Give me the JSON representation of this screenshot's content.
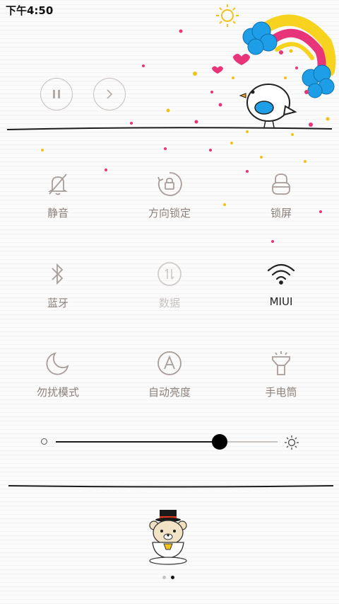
{
  "status_bar": {
    "time": "下午4:50"
  },
  "media": {
    "pause_label": "",
    "next_label": ""
  },
  "toggles": [
    {
      "label": "静音",
      "icon": "bell-off-icon",
      "state": "off"
    },
    {
      "label": "方向锁定",
      "icon": "rotation-lock-icon",
      "state": "off"
    },
    {
      "label": "锁屏",
      "icon": "lock-icon",
      "state": "off"
    },
    {
      "label": "蓝牙",
      "icon": "bluetooth-icon",
      "state": "off"
    },
    {
      "label": "数据",
      "icon": "mobile-data-icon",
      "state": "disabled"
    },
    {
      "label": "MIUI",
      "icon": "wifi-icon",
      "state": "on"
    },
    {
      "label": "勿扰模式",
      "icon": "moon-icon",
      "state": "off"
    },
    {
      "label": "自动亮度",
      "icon": "auto-brightness-icon",
      "state": "off"
    },
    {
      "label": "手电筒",
      "icon": "flashlight-icon",
      "state": "off"
    }
  ],
  "brightness": {
    "level": 0.74
  },
  "pager": {
    "count": 2,
    "active": 1
  },
  "colors": {
    "icon_inactive": "#8c807b",
    "icon_active": "#222222",
    "icon_disabled": "#c9c3c0",
    "rainbow_yellow": "#f7d21f",
    "rainbow_pink": "#e8357a",
    "cloud_blue": "#1e9ee6"
  }
}
